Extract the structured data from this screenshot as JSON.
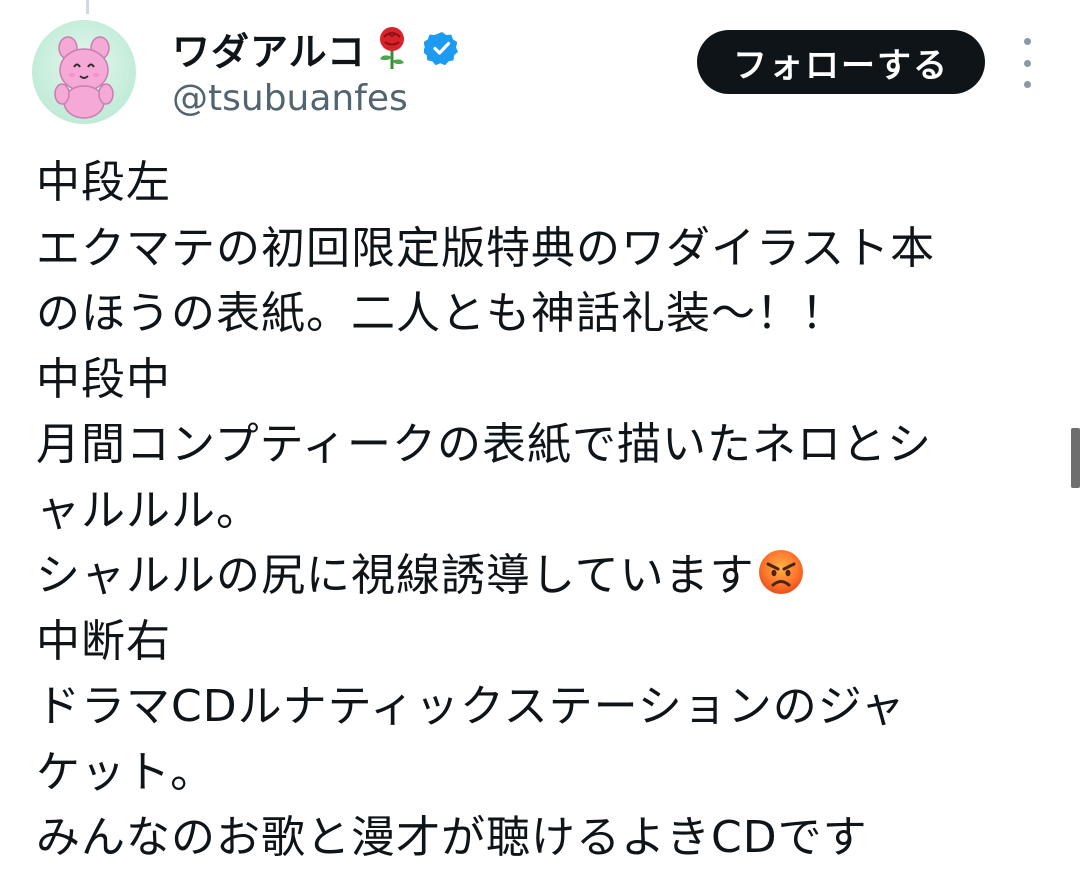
{
  "user": {
    "display_name": "ワダアルコ",
    "name_emoji": "rose-icon",
    "verified_icon": "verified-badge-icon",
    "handle": "@tsubuanfes"
  },
  "actions": {
    "follow_label": "フォローする",
    "more_icon": "more-options-icon"
  },
  "tweet": {
    "lines": [
      "中段左",
      "エクマテの初回限定版特典のワダイラスト本",
      "のほうの表紙。二人とも神話礼装〜！！",
      "中段中",
      "月間コンプティークの表紙で描いたネロとシ",
      "ャルルル。",
      "シャルルの尻に視線誘導しています",
      "中断右",
      "ドラマCDルナティックステーションのジャ",
      "ケット。",
      "みんなのお歌と漫才が聴けるよきCDです"
    ],
    "inline_emoji": "angry-face-icon"
  },
  "colors": {
    "text": "#0f1419",
    "secondary_text": "#536471",
    "follow_bg": "#0f1419",
    "verified_blue": "#1d9bf0",
    "avatar_bg": "#c9eedd",
    "character_pink": "#f4a9d6"
  }
}
